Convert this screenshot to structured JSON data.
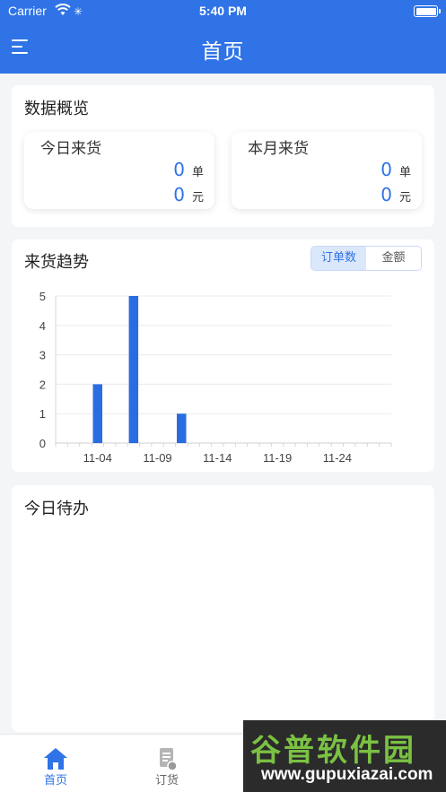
{
  "status_bar": {
    "carrier": "Carrier",
    "time": "5:40 PM"
  },
  "header": {
    "title": "首页",
    "menu_icon": "menu-icon"
  },
  "overview": {
    "title": "数据概览",
    "today": {
      "label": "今日来货",
      "orders": "0",
      "orders_unit": "单",
      "amount": "0",
      "amount_unit": "元"
    },
    "month": {
      "label": "本月来货",
      "orders": "0",
      "orders_unit": "单",
      "amount": "0",
      "amount_unit": "元"
    }
  },
  "trend": {
    "title": "来货趋势",
    "toggle": {
      "options": [
        "订单数",
        "金额"
      ],
      "selected": "订单数"
    }
  },
  "todo": {
    "title": "今日待办"
  },
  "tabbar": {
    "items": [
      {
        "label": "首页",
        "icon": "home-icon",
        "active": true
      },
      {
        "label": "订货",
        "icon": "order-document-icon",
        "active": false
      }
    ]
  },
  "watermark": {
    "text": "谷普软件园",
    "url": "www.gupuxiazai.com"
  },
  "colors": {
    "primary": "#2f73e6",
    "background": "#f4f5f7",
    "bar": "#2a6de0"
  },
  "chart_data": {
    "type": "bar",
    "x_ticks": [
      "11-04",
      "11-09",
      "11-14",
      "11-19",
      "11-24"
    ],
    "x_start_date": "11-01",
    "day_count": 28,
    "series": [
      {
        "values": [
          0,
          0,
          0,
          2,
          0,
          0,
          5,
          0,
          0,
          0,
          1,
          0,
          0,
          0,
          0,
          0,
          0,
          0,
          0,
          0,
          0,
          0,
          0,
          0,
          0,
          0,
          0,
          0
        ]
      }
    ],
    "ylim": [
      0,
      5
    ],
    "y_ticks": [
      0,
      1,
      2,
      3,
      4,
      5
    ],
    "grid": true
  }
}
